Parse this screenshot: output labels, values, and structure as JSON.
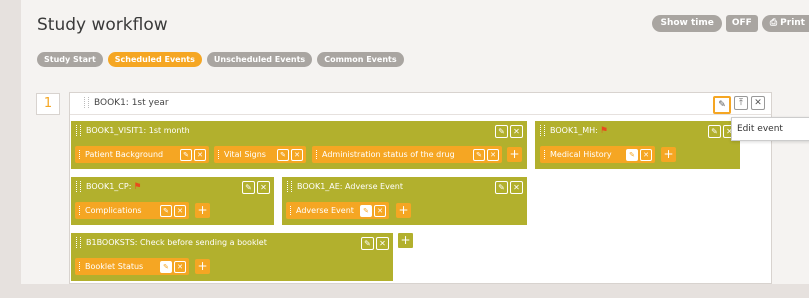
{
  "page_title": "Study workflow",
  "top_buttons": {
    "show_time": "Show time",
    "off": "OFF",
    "print": "Print"
  },
  "tabs": [
    "Study Start",
    "Scheduled Events",
    "Unscheduled Events",
    "Common Events"
  ],
  "active_tab": "Scheduled Events",
  "book": {
    "number": "1",
    "title": "BOOK1: 1st year",
    "visits": [
      {
        "title": "BOOK1_VISIT1: 1st month",
        "flag": false,
        "forms": [
          "Patient Background",
          "Vital Signs",
          "Administration status of the drug"
        ]
      },
      {
        "title": "BOOK1_MH:",
        "flag": true,
        "forms": [
          "Medical History"
        ]
      },
      {
        "title": "BOOK1_CP:",
        "flag": true,
        "forms": [
          "Complications"
        ]
      },
      {
        "title": "BOOK1_AE: Adverse Event",
        "flag": false,
        "forms": [
          "Adverse Event"
        ]
      },
      {
        "title": "B1BOOKSTS: Check before sending a booklet",
        "flag": false,
        "forms": [
          "Booklet Status"
        ]
      }
    ]
  },
  "tooltip": "Edit event",
  "colors": {
    "accent": "#f5a623",
    "visit": "#b2b02d",
    "tab_inactive": "#a9a5a1"
  }
}
